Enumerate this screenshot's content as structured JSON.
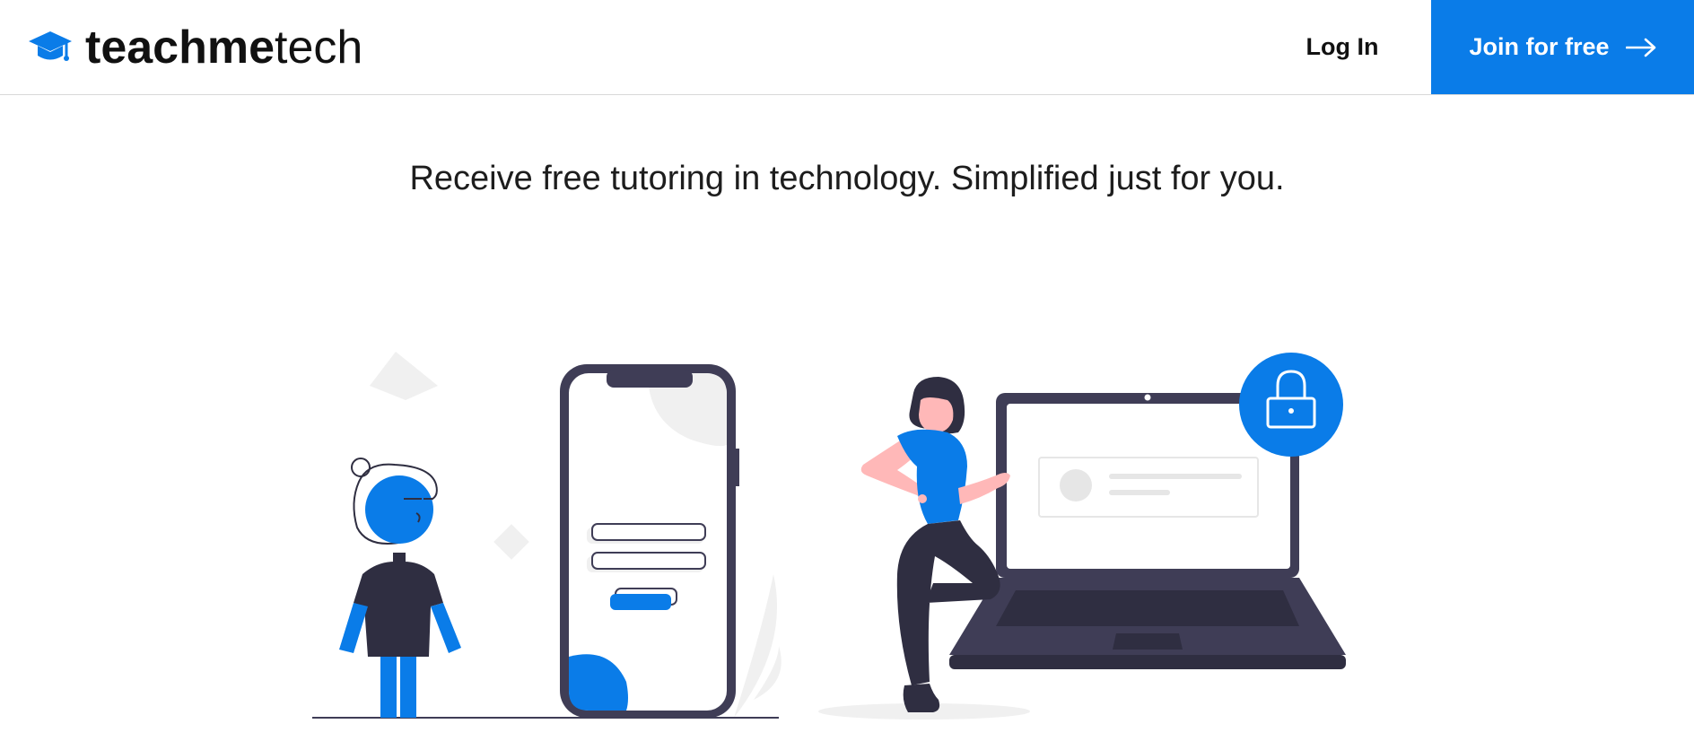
{
  "header": {
    "logo_bold": "teachme",
    "logo_light": "tech",
    "login_label": "Log In",
    "join_label": "Join for free"
  },
  "hero": {
    "tagline": "Receive free tutoring in technology. Simplified just for you."
  },
  "icons": {
    "logo": "graduation-cap-icon",
    "join_arrow": "arrow-right-icon",
    "lock": "lock-icon"
  },
  "colors": {
    "brand_blue": "#0a7ce8",
    "dark": "#2f2e41",
    "device_frame": "#3f3d56",
    "skin": "#ffb8b8",
    "light_gray": "#f0f0f0"
  }
}
